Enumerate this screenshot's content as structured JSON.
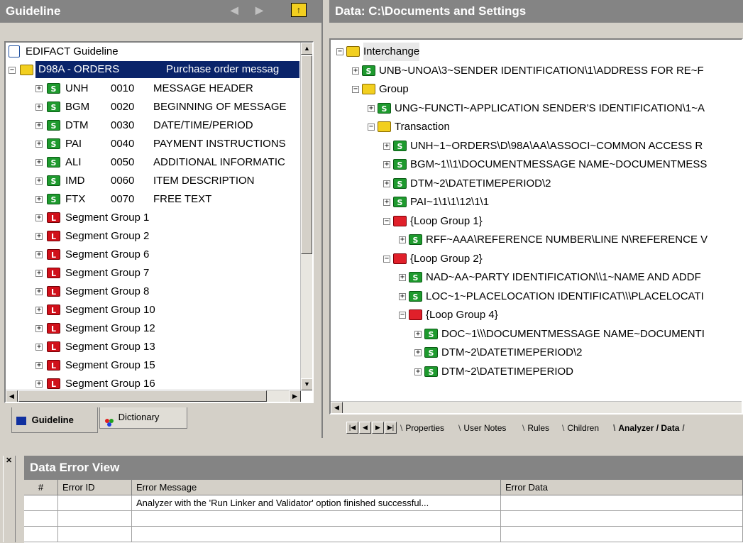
{
  "guideline_panel": {
    "title": "Guideline",
    "root_label": "EDIFACT Guideline",
    "selected": {
      "code": "D98A - ORDERS",
      "desc": "Purchase order messag"
    },
    "segments": [
      {
        "code": "UNH",
        "num": "0010",
        "desc": "MESSAGE HEADER"
      },
      {
        "code": "BGM",
        "num": "0020",
        "desc": "BEGINNING OF MESSAGE"
      },
      {
        "code": "DTM",
        "num": "0030",
        "desc": "DATE/TIME/PERIOD"
      },
      {
        "code": "PAI",
        "num": "0040",
        "desc": "PAYMENT INSTRUCTIONS"
      },
      {
        "code": "ALI",
        "num": "0050",
        "desc": "ADDITIONAL INFORMATIC"
      },
      {
        "code": "IMD",
        "num": "0060",
        "desc": "ITEM DESCRIPTION"
      },
      {
        "code": "FTX",
        "num": "0070",
        "desc": "FREE TEXT"
      }
    ],
    "groups": [
      "Segment Group 1",
      "Segment Group 2",
      "Segment Group 6",
      "Segment Group 7",
      "Segment Group 8",
      "Segment Group 10",
      "Segment Group 12",
      "Segment Group 13",
      "Segment Group 15",
      "Segment Group 16"
    ],
    "tabs": {
      "guideline": "Guideline",
      "dictionary": "Dictionary"
    }
  },
  "data_panel": {
    "title": "Data: C:\\Documents and Settings",
    "nodes": [
      {
        "label": "Interchange",
        "icon": "folder",
        "level": 0
      },
      {
        "label": "UNB~UNOA\\3~SENDER IDENTIFICATION\\1\\ADDRESS FOR RE~F",
        "icon": "segment",
        "level": 1
      },
      {
        "label": "Group",
        "icon": "folder",
        "level": 1
      },
      {
        "label": "UNG~FUNCTI~APPLICATION SENDER'S IDENTIFICATION\\1~A",
        "icon": "segment",
        "level": 2
      },
      {
        "label": "Transaction",
        "icon": "folder",
        "level": 2
      },
      {
        "label": "UNH~1~ORDERS\\D\\98A\\AA\\ASSOCI~COMMON ACCESS R",
        "icon": "segment",
        "level": 3
      },
      {
        "label": "BGM~1\\\\1\\DOCUMENTMESSAGE NAME~DOCUMENTMESS",
        "icon": "segment",
        "level": 3
      },
      {
        "label": "DTM~2\\DATETIMEPERIOD\\2",
        "icon": "segment",
        "level": 3
      },
      {
        "label": "PAI~1\\1\\1\\12\\1\\1",
        "icon": "segment",
        "level": 3
      },
      {
        "label": "{Loop Group 1}",
        "icon": "loop",
        "level": 3
      },
      {
        "label": "RFF~AAA\\REFERENCE NUMBER\\LINE N\\REFERENCE V",
        "icon": "segment",
        "level": 4
      },
      {
        "label": "{Loop Group 2}",
        "icon": "loop",
        "level": 3
      },
      {
        "label": "NAD~AA~PARTY IDENTIFICATION\\\\1~NAME AND ADDF",
        "icon": "segment",
        "level": 4
      },
      {
        "label": "LOC~1~PLACELOCATION IDENTIFICAT\\\\\\PLACELOCATI",
        "icon": "segment",
        "level": 4
      },
      {
        "label": "{Loop Group 4}",
        "icon": "loop",
        "level": 4
      },
      {
        "label": "DOC~1\\\\\\DOCUMENTMESSAGE NAME~DOCUMENTI",
        "icon": "segment",
        "level": 5
      },
      {
        "label": "DTM~2\\DATETIMEPERIOD\\2",
        "icon": "segment",
        "level": 5
      },
      {
        "label": "DTM~2\\DATETIMEPERIOD",
        "icon": "segment",
        "level": 5
      }
    ],
    "tabs": [
      "Properties",
      "User Notes",
      "Rules",
      "Children",
      "Analyzer / Data"
    ]
  },
  "error_view": {
    "title": "Data Error View",
    "columns": [
      "#",
      "Error ID",
      "Error Message",
      "Error Data"
    ],
    "rows": [
      {
        "num": "",
        "id": "",
        "message": "Analyzer with the 'Run Linker and Validator' option finished successful...",
        "data": ""
      }
    ]
  },
  "colors": {
    "titlebar": "#848484",
    "selection": "#0a246a",
    "segment_icon": "#1e9a2e",
    "loop_icon": "#d0101a",
    "folder_icon": "#f2cf1f"
  }
}
